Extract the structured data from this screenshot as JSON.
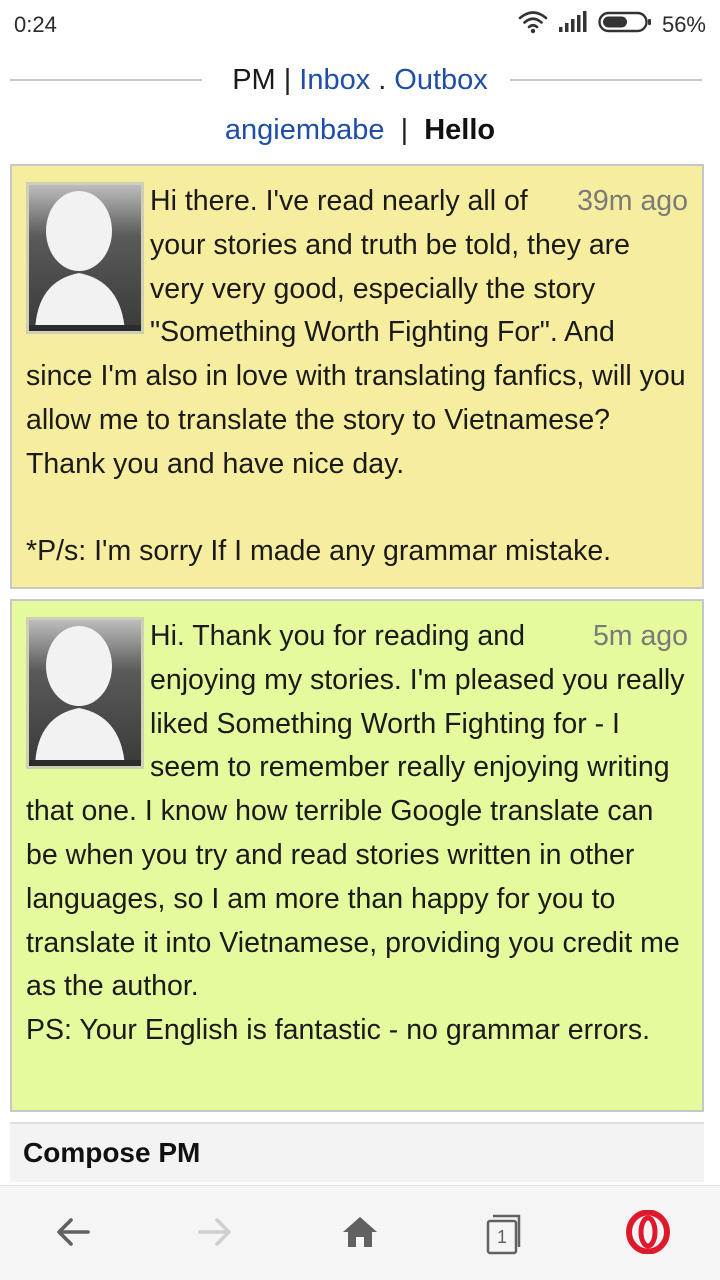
{
  "status": {
    "time": "0:24",
    "battery": "56%"
  },
  "header": {
    "pm": "PM",
    "sep1": "|",
    "inbox": "Inbox",
    "sep2": ".",
    "outbox": "Outbox",
    "user": "angiembabe",
    "sep3": "|",
    "title": "Hello"
  },
  "messages": [
    {
      "time": "39m ago",
      "text": "Hi there. I've read nearly all of your stories and truth be told, they are very very good, especially the story \"Something Worth Fighting For\". And since I'm also in love with translating fanfics, will you allow me to translate the story to Vietnamese? Thank you and have nice day.\n\n*P/s: I'm sorry If I made any grammar mistake."
    },
    {
      "time": "5m ago",
      "text": "Hi. Thank you for reading and enjoying my stories. I'm pleased you really liked Something Worth Fighting for - I seem to remember really enjoying writing that one. I know how terrible Google translate can be when you try and read stories written in other languages, so I am more than happy for you to translate it into Vietnamese, providing you credit me as the author.\nPS: Your English is fantastic - no grammar errors."
    }
  ],
  "compose": {
    "label": "Compose PM"
  },
  "nav": {
    "tab_count": "1"
  },
  "colors": {
    "link": "#1f4ea8",
    "msg_received": "#f6ee9e",
    "msg_sent": "#e4fa9c",
    "opera_red": "#e0182d"
  },
  "icons": [
    "wifi-icon",
    "signal-icon",
    "battery-icon",
    "back-arrow-icon",
    "forward-arrow-icon",
    "home-icon",
    "tabs-icon",
    "opera-icon"
  ]
}
